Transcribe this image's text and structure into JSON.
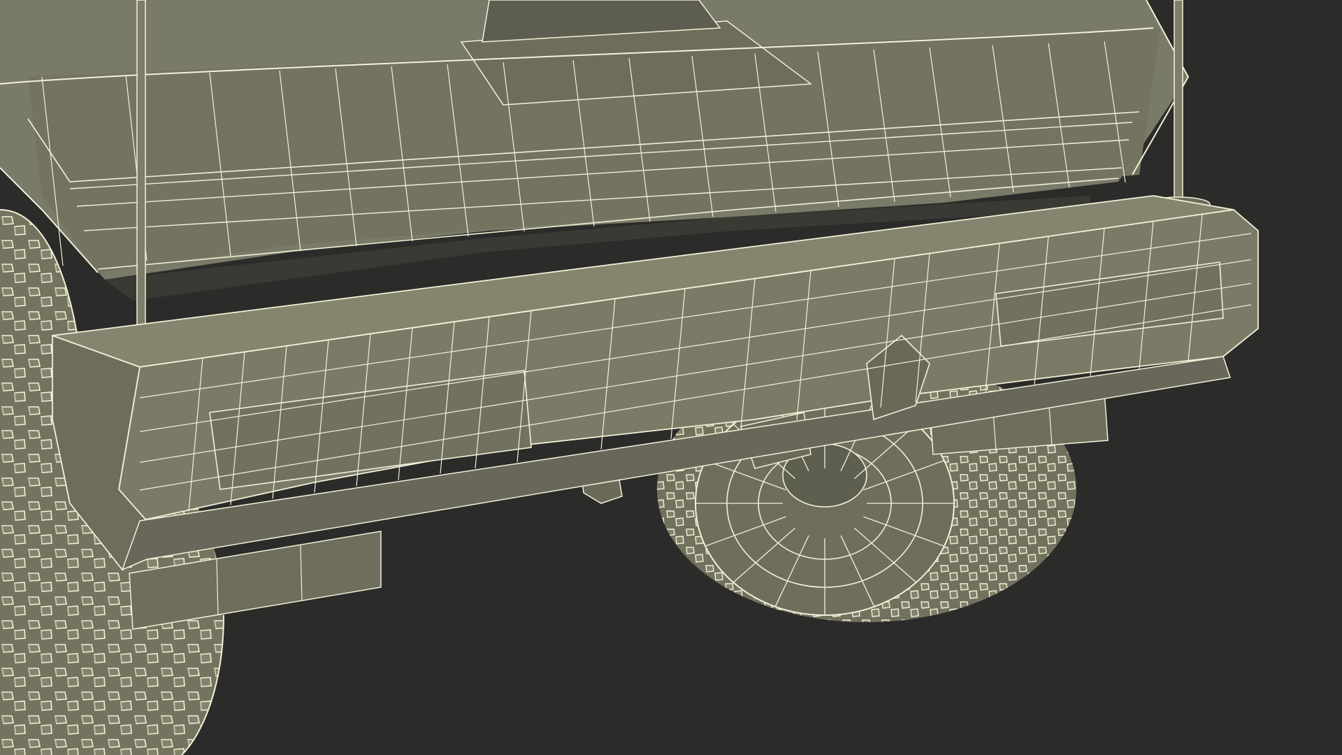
{
  "scene": {
    "subject": "wireframe-render",
    "colors": {
      "background": "#2b2b2a",
      "surface": "#7a7a68",
      "surface_dark": "#6c6c5b",
      "surface_shadow": "#5e5e50",
      "wire": "#f2f1d8",
      "wire_dim": "#c9c8ae"
    }
  }
}
